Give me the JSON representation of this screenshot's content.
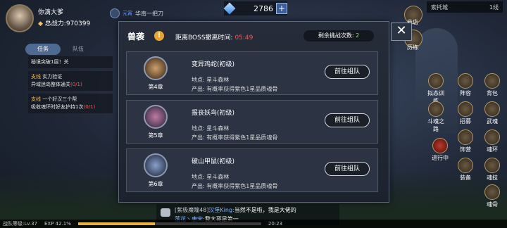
{
  "player": {
    "name": "你滴大爹",
    "power_label": "总战力:",
    "power_value": "970399"
  },
  "guild": {
    "label": "华南一把刀",
    "prefix": "元宵"
  },
  "currency": {
    "amount": "2786",
    "plus": "+"
  },
  "location": {
    "city": "索托城",
    "line": "1线"
  },
  "quest_panel": {
    "tabs": [
      "任务",
      "队伍"
    ],
    "quests": [
      {
        "kind": "",
        "title": "秘境突破1层！关",
        "progress": ""
      },
      {
        "kind": "支线",
        "title": "实力验证",
        "detail": "异域迷岛整体通关",
        "progress": "(0/1)"
      },
      {
        "kind": "支线",
        "title": "一个好汉三个帮",
        "detail": "吸收魂环时好友护持1次",
        "progress": "(0/1)"
      }
    ]
  },
  "modal": {
    "title": "兽袭",
    "info": "!",
    "timer_label": "距离BOSS撤离时间:",
    "timer_value": "05:49",
    "remain_label": "剩余挑战次数:",
    "remain_value": "2",
    "close": "✕",
    "bosses": [
      {
        "chapter": "第4章",
        "name": "变异鸡蛇(初级)",
        "location": "地点: 星斗森林",
        "drop": "产出: 有概率获得紫色1星品质魂骨",
        "button": "前往组队",
        "color": "#7a5a3a"
      },
      {
        "chapter": "第5章",
        "name": "报丧妖鸟(初级)",
        "location": "地点: 星斗森林",
        "drop": "产出: 有概率获得紫色1星品质魂骨",
        "button": "前往组队",
        "color": "#6a4a6a"
      },
      {
        "chapter": "第6章",
        "name": "破山甲鼠(初级)",
        "location": "地点: 星斗森林",
        "drop": "产出: 有概率获得紫色1星品质魂骨",
        "button": "前往组队",
        "color": "#4a5a7a"
      }
    ]
  },
  "side_menu": {
    "top": [
      {
        "label": "商店",
        "icon": "shop-icon"
      },
      {
        "label": "历练",
        "icon": "training-icon"
      }
    ],
    "grid": [
      {
        "label": "拟态训练",
        "icon": "mimic-training-icon"
      },
      {
        "label": "阵容",
        "icon": "lineup-icon"
      },
      {
        "label": "背包",
        "icon": "bag-icon"
      },
      {
        "label": "斗魂之路",
        "icon": "soul-road-icon"
      },
      {
        "label": "招募",
        "icon": "recruit-icon"
      },
      {
        "label": "武魂",
        "icon": "martial-soul-icon"
      },
      {
        "label": "进行中",
        "icon": "in-progress-icon"
      },
      {
        "label": "饰营",
        "icon": "camp-icon"
      },
      {
        "label": "魂环",
        "icon": "soul-ring-icon"
      },
      {
        "label": "装备",
        "icon": "equipment-icon"
      },
      {
        "label": "魂技",
        "icon": "soul-skill-icon"
      },
      {
        "label": "魂骨",
        "icon": "soul-bone-icon"
      }
    ]
  },
  "chat": {
    "line1_tag": "[紫极魔瞳48]",
    "line1_name": "汉堡King:",
    "line1_text": "当然不是啦，我是大佬的",
    "line2_name": "落花丶唐宋:",
    "line2_text": "我大哥是第一"
  },
  "status": {
    "level": "战队等级:Lv.37",
    "exp": "EXP 42.1%",
    "exp_fraction": 0.421,
    "time": "20:23"
  }
}
